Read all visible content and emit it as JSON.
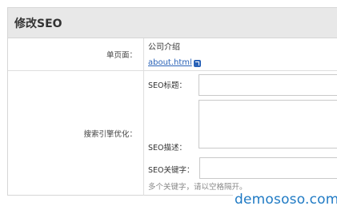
{
  "panel": {
    "title": "修改SEO"
  },
  "page_row": {
    "label": "单页面：",
    "page_name": "公司介绍",
    "page_link": "about.html"
  },
  "seo_row": {
    "label": "搜索引擎优化：",
    "title_label": "SEO标题：",
    "title_value": "",
    "desc_label": "SEO描述：",
    "desc_value": "",
    "keywords_label": "SEO关键字：",
    "keywords_value": "",
    "keywords_hint": "多个关键字，请以空格隔开。"
  },
  "watermark": "demososo.com",
  "icons": {
    "external_link": "external-link-icon"
  }
}
